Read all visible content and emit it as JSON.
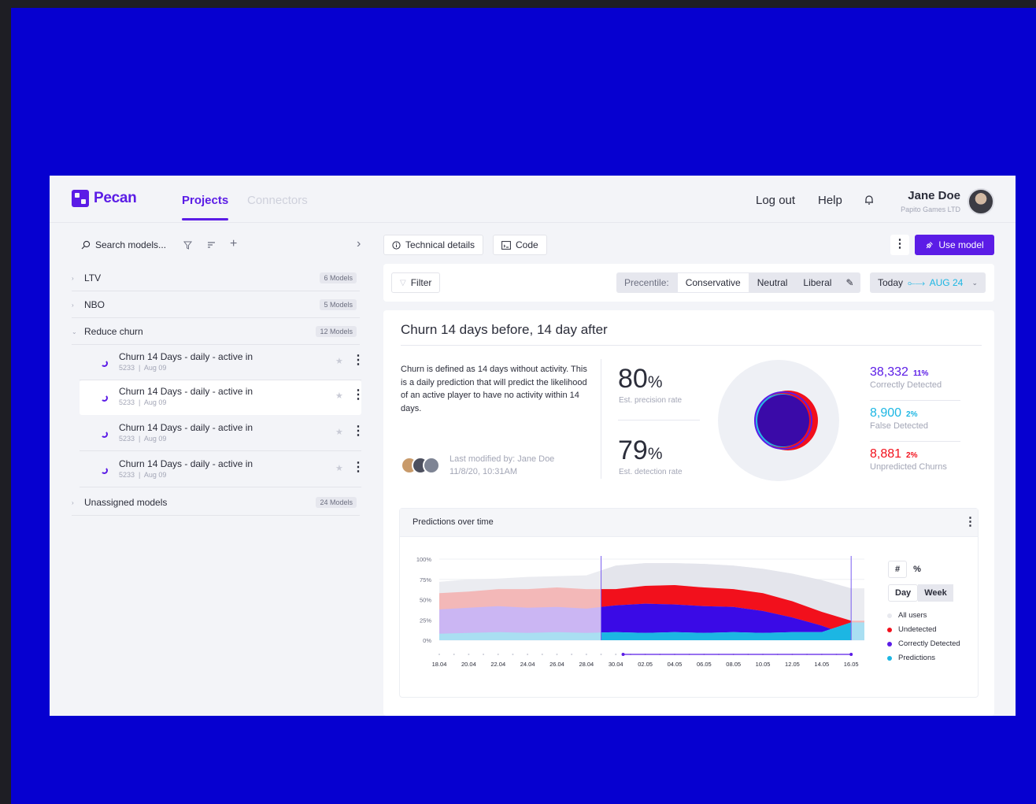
{
  "app": {
    "logo": "Pecan",
    "nav": {
      "projects": "Projects",
      "connectors": "Connectors"
    },
    "logout": "Log out",
    "help": "Help",
    "user": {
      "name": "Jane Doe",
      "org": "Papito Games LTD"
    }
  },
  "sidebar": {
    "search_placeholder": "Search models...",
    "groups": [
      {
        "label": "LTV",
        "badge": "6 Models"
      },
      {
        "label": "NBO",
        "badge": "5 Models"
      },
      {
        "label": "Reduce churn",
        "badge": "12 Models"
      },
      {
        "label": "Unassigned models",
        "badge": "24 Models"
      }
    ],
    "models": [
      {
        "name": "Churn 14 Days - daily - active in",
        "id": "5233",
        "date": "Aug 09"
      },
      {
        "name": "Churn 14 Days - daily - active in",
        "id": "5233",
        "date": "Aug 09"
      },
      {
        "name": "Churn 14 Days - daily - active in",
        "id": "5233",
        "date": "Aug 09"
      },
      {
        "name": "Churn 14 Days - daily - active in",
        "id": "5233",
        "date": "Aug 09"
      }
    ]
  },
  "toolbar": {
    "technical": "Technical details",
    "code": "Code",
    "use_model": "Use model"
  },
  "filters": {
    "filter": "Filter",
    "percentile_label": "Precentile:",
    "options": [
      "Conservative",
      "Neutral",
      "Liberal"
    ],
    "date_from": "Today",
    "date_to": "AUG 24"
  },
  "model": {
    "title": "Churn 14 days before, 14 day after",
    "description": "Churn is defined as 14 days without activity. This is a daily prediction that will predict the likelihood of an active player to have no activity within 14 days.",
    "modified_by": "Last modified by: Jane Doe",
    "modified_at": "11/8/20, 10:31AM",
    "precision": {
      "value": "80",
      "unit": "%",
      "label": "Est. precision rate"
    },
    "detection": {
      "value": "79",
      "unit": "%",
      "label": "Est. detection rate"
    },
    "stats": [
      {
        "value": "38,332",
        "pct": "11%",
        "label": "Correctly Detected",
        "color": "#5b1ce6"
      },
      {
        "value": "8,900",
        "pct": "2%",
        "label": "False Detected",
        "color": "#1cb6e3"
      },
      {
        "value": "8,881",
        "pct": "2%",
        "label": "Unpredicted Churns",
        "color": "#f2101c"
      }
    ]
  },
  "predictions": {
    "title": "Predictions over time",
    "unit_toggle": [
      "#",
      "%"
    ],
    "period_toggle": [
      "Day",
      "Week"
    ],
    "legend": [
      {
        "label": "All users",
        "color": "#e8e9ef"
      },
      {
        "label": "Undetected",
        "color": "#f2101c"
      },
      {
        "label": "Correctly Detected",
        "color": "#5b1ce6"
      },
      {
        "label": "Predictions",
        "color": "#1cb6e3"
      }
    ]
  },
  "chart_data": {
    "type": "area",
    "title": "Predictions over time",
    "x": [
      "18.04",
      "20.04",
      "22.04",
      "24.04",
      "26.04",
      "28.04",
      "30.04",
      "02.05",
      "04.05",
      "06.05",
      "08.05",
      "10.05",
      "12.05",
      "14.05",
      "16.05"
    ],
    "y_ticks": [
      "100%",
      "75%",
      "50%",
      "25%",
      "0%"
    ],
    "ylim": [
      0,
      100
    ],
    "selection": [
      "29.04",
      "16.05"
    ],
    "series": [
      {
        "name": "All users",
        "values": [
          72,
          75,
          76,
          78,
          79,
          80,
          92,
          95,
          95,
          94,
          92,
          88,
          82,
          74,
          64
        ]
      },
      {
        "name": "Undetected",
        "values": [
          58,
          60,
          63,
          63,
          65,
          63,
          63,
          67,
          68,
          65,
          63,
          58,
          48,
          35,
          24
        ]
      },
      {
        "name": "Correctly Detected",
        "values": [
          38,
          40,
          42,
          40,
          41,
          39,
          43,
          45,
          44,
          42,
          41,
          36,
          28,
          18,
          5
        ]
      },
      {
        "name": "Predictions",
        "values": [
          8,
          9,
          10,
          9,
          10,
          9,
          10,
          9,
          10,
          9,
          10,
          9,
          10,
          10,
          22
        ]
      }
    ]
  }
}
